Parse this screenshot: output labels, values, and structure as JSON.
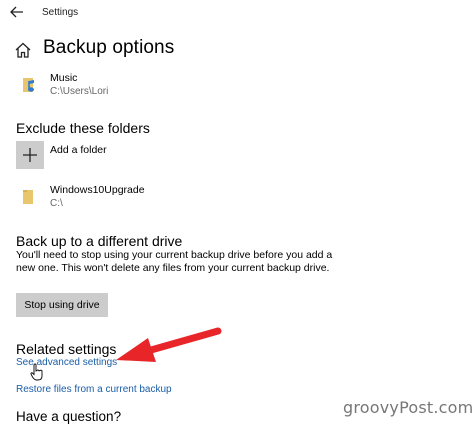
{
  "window": {
    "title": "Settings"
  },
  "page": {
    "title": "Backup options"
  },
  "backup_folders": [
    {
      "name": "Music",
      "path": "C:\\Users\\Lori"
    }
  ],
  "exclude": {
    "heading": "Exclude these folders",
    "add_label": "Add a folder",
    "folders": [
      {
        "name": "Windows10Upgrade",
        "path": "C:\\"
      }
    ]
  },
  "different_drive": {
    "heading": "Back up to a different drive",
    "description": "You'll need to stop using your current backup drive before you add a new one. This won't delete any files from your current backup drive.",
    "button_label": "Stop using drive"
  },
  "related": {
    "heading": "Related settings",
    "links": [
      "See advanced settings",
      "Restore files from a current backup"
    ]
  },
  "question": {
    "heading": "Have a question?"
  },
  "watermark": "groovyPost.com",
  "colors": {
    "link": "#1a5ea8",
    "arrow": "#e8262a",
    "button_bg": "#cccccc"
  }
}
